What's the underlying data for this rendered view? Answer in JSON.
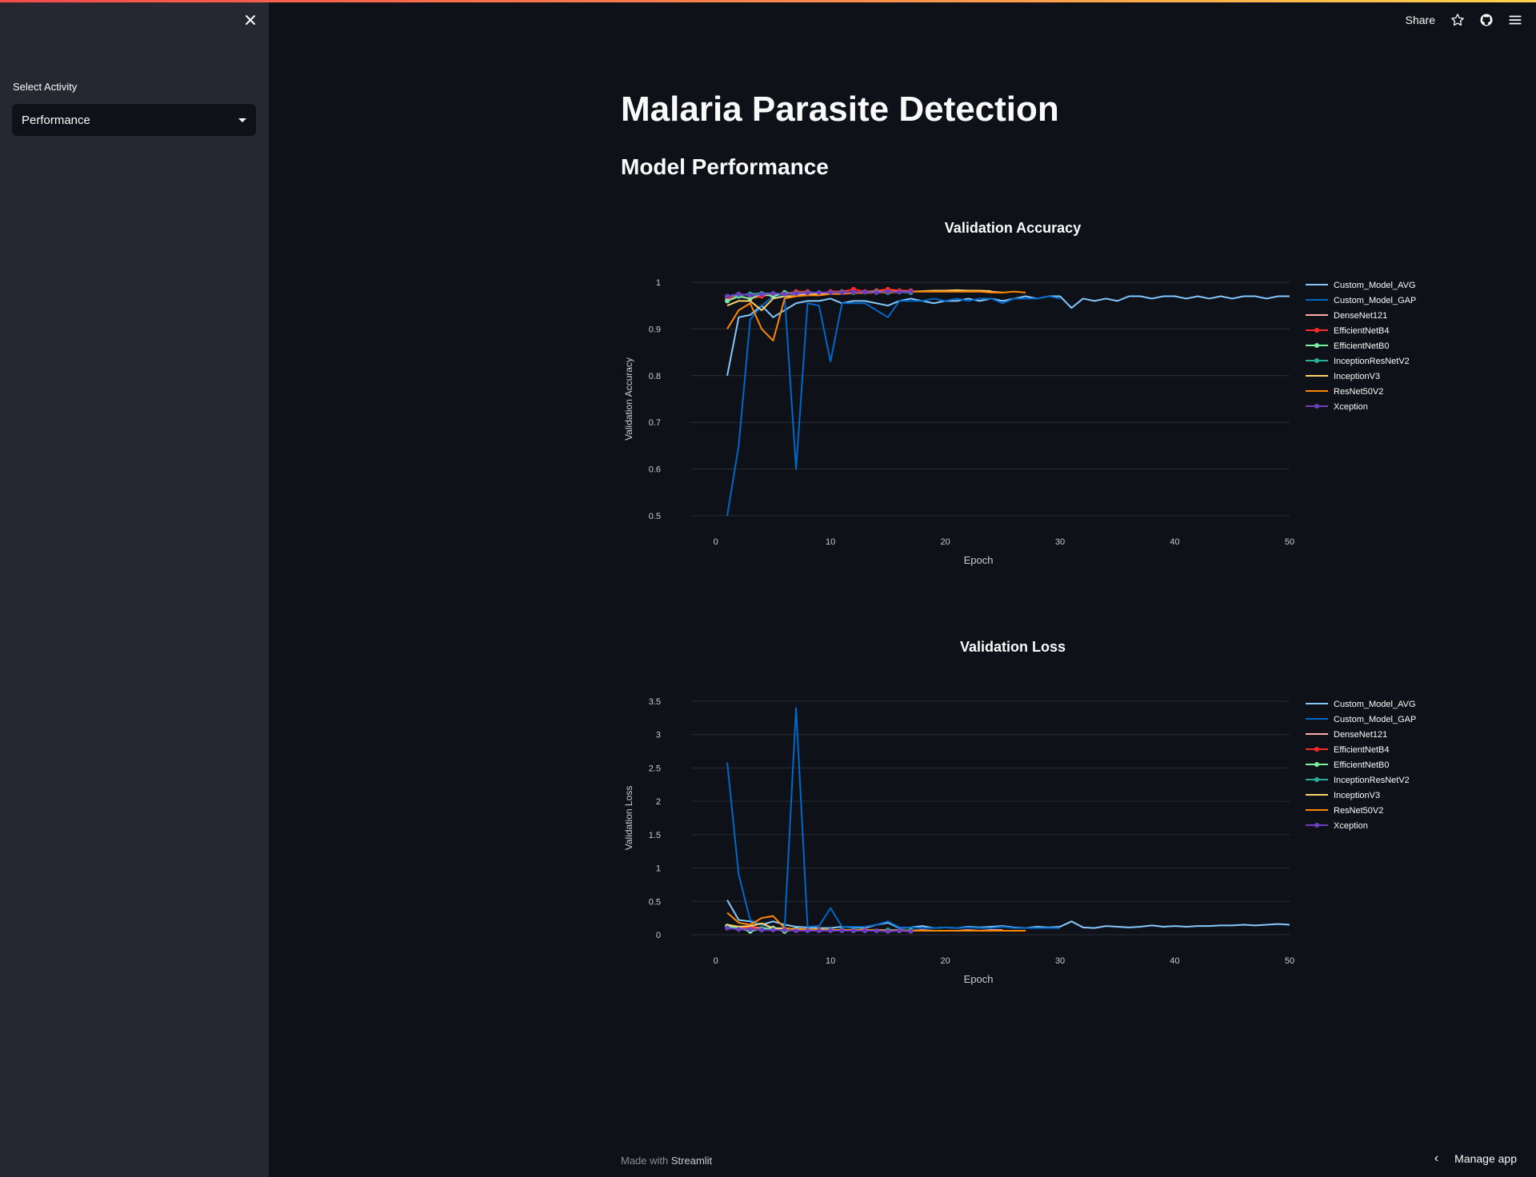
{
  "sidebar": {
    "select_label": "Select Activity",
    "select_value": "Performance"
  },
  "header": {
    "share_label": "Share"
  },
  "main": {
    "title": "Malaria Parasite Detection",
    "subtitle": "Model Performance"
  },
  "footer": {
    "made_with": "Made with",
    "brand": "Streamlit",
    "manage_app": "Manage app"
  },
  "chart_data": [
    {
      "type": "line",
      "title": "Validation Accuracy",
      "xlabel": "Epoch",
      "ylabel": "Validation Accuracy",
      "xlim": [
        -2,
        50
      ],
      "ylim": [
        0.5,
        1
      ],
      "xticks": [
        0,
        10,
        20,
        30,
        40,
        50
      ],
      "yticks": [
        0.5,
        0.6,
        0.7,
        0.8,
        0.9,
        1
      ],
      "grid": true,
      "legend_position": "right",
      "series": [
        {
          "name": "Custom_Model_AVG",
          "color": "#83c9ff",
          "marker": false,
          "x": [
            1,
            2,
            3,
            4,
            5,
            6,
            7,
            8,
            9,
            10,
            11,
            12,
            13,
            14,
            15,
            16,
            17,
            18,
            19,
            20,
            21,
            22,
            23,
            24,
            25,
            26,
            27,
            28,
            29,
            30,
            31,
            32,
            33,
            34,
            35,
            36,
            37,
            38,
            39,
            40,
            41,
            42,
            43,
            44,
            45,
            46,
            47,
            48,
            49,
            50
          ],
          "y": [
            0.8,
            0.925,
            0.93,
            0.95,
            0.925,
            0.94,
            0.955,
            0.96,
            0.96,
            0.965,
            0.955,
            0.96,
            0.96,
            0.955,
            0.95,
            0.96,
            0.965,
            0.96,
            0.955,
            0.96,
            0.96,
            0.965,
            0.96,
            0.965,
            0.96,
            0.965,
            0.97,
            0.965,
            0.97,
            0.97,
            0.945,
            0.965,
            0.96,
            0.965,
            0.96,
            0.97,
            0.97,
            0.965,
            0.97,
            0.97,
            0.965,
            0.97,
            0.965,
            0.97,
            0.965,
            0.97,
            0.97,
            0.965,
            0.97,
            0.97
          ]
        },
        {
          "name": "Custom_Model_GAP",
          "color": "#0068c9",
          "marker": false,
          "x": [
            1,
            2,
            3,
            4,
            5,
            6,
            7,
            8,
            9,
            10,
            11,
            12,
            13,
            14,
            15,
            16,
            17,
            18,
            19,
            20,
            21,
            22,
            23,
            24,
            25,
            26,
            27,
            28,
            29,
            30
          ],
          "y": [
            0.5,
            0.65,
            0.92,
            0.95,
            0.97,
            0.97,
            0.6,
            0.955,
            0.95,
            0.83,
            0.955,
            0.955,
            0.955,
            0.94,
            0.925,
            0.96,
            0.96,
            0.96,
            0.965,
            0.96,
            0.965,
            0.96,
            0.965,
            0.965,
            0.955,
            0.965,
            0.965,
            0.965,
            0.97,
            0.965
          ]
        },
        {
          "name": "DenseNet121",
          "color": "#ffabab",
          "marker": false,
          "x": [
            1,
            2,
            3,
            4,
            5,
            6,
            7,
            8,
            9,
            10,
            11,
            12,
            13,
            14,
            15,
            16,
            17,
            18,
            19,
            20,
            21,
            22,
            23,
            24,
            25
          ],
          "y": [
            0.96,
            0.97,
            0.965,
            0.97,
            0.975,
            0.975,
            0.975,
            0.975,
            0.975,
            0.98,
            0.98,
            0.978,
            0.98,
            0.98,
            0.98,
            0.98,
            0.98,
            0.98,
            0.98,
            0.98,
            0.98,
            0.98,
            0.98,
            0.98,
            0.978
          ]
        },
        {
          "name": "EfficientNetB4",
          "color": "#ff2b2b",
          "marker": true,
          "x": [
            1,
            2,
            3,
            4,
            5,
            6,
            7,
            8,
            9,
            10,
            11,
            12,
            13,
            14,
            15,
            16,
            17
          ],
          "y": [
            0.965,
            0.97,
            0.965,
            0.97,
            0.975,
            0.975,
            0.98,
            0.98,
            0.975,
            0.98,
            0.98,
            0.985,
            0.98,
            0.982,
            0.985,
            0.982,
            0.982
          ]
        },
        {
          "name": "EfficientNetB0",
          "color": "#7defa1",
          "marker": true,
          "x": [
            1,
            2,
            3,
            4,
            5,
            6,
            7
          ],
          "y": [
            0.96,
            0.97,
            0.965,
            0.975,
            0.97,
            0.978,
            0.975
          ]
        },
        {
          "name": "InceptionResNetV2",
          "color": "#29b09d",
          "marker": true,
          "x": [
            1,
            2,
            3,
            4,
            5,
            6,
            7,
            8,
            9,
            10,
            11,
            12,
            13,
            14,
            15,
            16,
            17
          ],
          "y": [
            0.97,
            0.972,
            0.975,
            0.976,
            0.976,
            0.975,
            0.977,
            0.978,
            0.978,
            0.978,
            0.979,
            0.978,
            0.979,
            0.98,
            0.978,
            0.979,
            0.978
          ]
        },
        {
          "name": "InceptionV3",
          "color": "#ffd16a",
          "marker": false,
          "x": [
            1,
            2,
            3,
            4,
            5,
            6,
            7,
            8,
            9,
            10,
            11,
            12,
            13,
            14,
            15,
            16,
            17,
            18,
            19,
            20,
            21,
            22,
            23,
            24
          ],
          "y": [
            0.95,
            0.96,
            0.96,
            0.94,
            0.965,
            0.97,
            0.97,
            0.975,
            0.975,
            0.976,
            0.977,
            0.978,
            0.978,
            0.979,
            0.98,
            0.98,
            0.98,
            0.981,
            0.982,
            0.982,
            0.983,
            0.982,
            0.982,
            0.981
          ]
        },
        {
          "name": "ResNet50V2",
          "color": "#ff8700",
          "marker": false,
          "x": [
            1,
            2,
            3,
            4,
            5,
            6,
            7,
            8,
            9,
            10,
            11,
            12,
            13,
            14,
            15,
            16,
            17,
            18,
            19,
            20,
            21,
            22,
            23,
            24,
            25,
            26,
            27
          ],
          "y": [
            0.9,
            0.94,
            0.955,
            0.9,
            0.875,
            0.965,
            0.97,
            0.972,
            0.972,
            0.975,
            0.975,
            0.977,
            0.977,
            0.978,
            0.978,
            0.979,
            0.98,
            0.98,
            0.98,
            0.98,
            0.98,
            0.98,
            0.98,
            0.978,
            0.978,
            0.98,
            0.978
          ]
        },
        {
          "name": "Xception",
          "color": "#6d3fc0",
          "marker": true,
          "x": [
            1,
            2,
            3,
            4,
            5,
            6,
            7,
            8,
            9,
            10,
            11,
            12,
            13,
            14,
            15,
            16,
            17
          ],
          "y": [
            0.97,
            0.975,
            0.972,
            0.974,
            0.976,
            0.975,
            0.976,
            0.977,
            0.978,
            0.978,
            0.978,
            0.979,
            0.979,
            0.978,
            0.98,
            0.979,
            0.98
          ]
        }
      ]
    },
    {
      "type": "line",
      "title": "Validation Loss",
      "xlabel": "Epoch",
      "ylabel": "Validation Loss",
      "xlim": [
        -2,
        50
      ],
      "ylim": [
        0,
        3.5
      ],
      "xticks": [
        0,
        10,
        20,
        30,
        40,
        50
      ],
      "yticks": [
        0,
        0.5,
        1,
        1.5,
        2,
        2.5,
        3,
        3.5
      ],
      "grid": true,
      "legend_position": "right",
      "series": [
        {
          "name": "Custom_Model_AVG",
          "color": "#83c9ff",
          "marker": false,
          "x": [
            1,
            2,
            3,
            4,
            5,
            6,
            7,
            8,
            9,
            10,
            11,
            12,
            13,
            14,
            15,
            16,
            17,
            18,
            19,
            20,
            21,
            22,
            23,
            24,
            25,
            26,
            27,
            28,
            29,
            30,
            31,
            32,
            33,
            34,
            35,
            36,
            37,
            38,
            39,
            40,
            41,
            42,
            43,
            44,
            45,
            46,
            47,
            48,
            49,
            50
          ],
          "y": [
            0.52,
            0.22,
            0.2,
            0.15,
            0.2,
            0.15,
            0.12,
            0.11,
            0.1,
            0.1,
            0.12,
            0.11,
            0.1,
            0.15,
            0.18,
            0.1,
            0.11,
            0.13,
            0.1,
            0.11,
            0.1,
            0.12,
            0.11,
            0.12,
            0.13,
            0.11,
            0.1,
            0.12,
            0.11,
            0.12,
            0.2,
            0.11,
            0.1,
            0.13,
            0.12,
            0.11,
            0.12,
            0.14,
            0.12,
            0.13,
            0.12,
            0.13,
            0.13,
            0.14,
            0.14,
            0.15,
            0.14,
            0.15,
            0.16,
            0.15
          ]
        },
        {
          "name": "Custom_Model_GAP",
          "color": "#0068c9",
          "marker": false,
          "x": [
            1,
            2,
            3,
            4,
            5,
            6,
            7,
            8,
            9,
            10,
            11,
            12,
            13,
            14,
            15,
            16,
            17,
            18,
            19,
            20,
            21,
            22,
            23,
            24,
            25,
            26,
            27,
            28,
            29,
            30
          ],
          "y": [
            2.58,
            0.9,
            0.22,
            0.15,
            0.1,
            0.1,
            3.4,
            0.12,
            0.13,
            0.4,
            0.12,
            0.12,
            0.12,
            0.15,
            0.2,
            0.11,
            0.11,
            0.1,
            0.1,
            0.11,
            0.1,
            0.11,
            0.1,
            0.1,
            0.12,
            0.1,
            0.1,
            0.1,
            0.1,
            0.1
          ]
        },
        {
          "name": "DenseNet121",
          "color": "#ffabab",
          "marker": false,
          "x": [
            1,
            2,
            3,
            4,
            5,
            6,
            7,
            8,
            9,
            10,
            11,
            12,
            13,
            14,
            15,
            16,
            17,
            18,
            19,
            20,
            21,
            22,
            23,
            24,
            25
          ],
          "y": [
            0.12,
            0.1,
            0.12,
            0.1,
            0.09,
            0.08,
            0.08,
            0.07,
            0.07,
            0.07,
            0.07,
            0.07,
            0.06,
            0.07,
            0.07,
            0.07,
            0.06,
            0.07,
            0.06,
            0.06,
            0.06,
            0.07,
            0.06,
            0.07,
            0.07
          ]
        },
        {
          "name": "EfficientNetB4",
          "color": "#ff2b2b",
          "marker": true,
          "x": [
            1,
            2,
            3,
            4,
            5,
            6,
            7,
            8,
            9,
            10,
            11,
            12,
            13,
            14,
            15,
            16,
            17
          ],
          "y": [
            0.12,
            0.1,
            0.11,
            0.09,
            0.08,
            0.08,
            0.07,
            0.07,
            0.08,
            0.07,
            0.07,
            0.06,
            0.07,
            0.06,
            0.06,
            0.06,
            0.06
          ]
        },
        {
          "name": "EfficientNetB0",
          "color": "#7defa1",
          "marker": true,
          "x": [
            1,
            2,
            3,
            4,
            5,
            6,
            7
          ],
          "y": [
            0.13,
            0.1,
            0.05,
            0.09,
            0.1,
            0.05,
            0.08
          ]
        },
        {
          "name": "InceptionResNetV2",
          "color": "#29b09d",
          "marker": true,
          "x": [
            1,
            2,
            3,
            4,
            5,
            6,
            7,
            8,
            9,
            10,
            11,
            12,
            13,
            14,
            15,
            16,
            17
          ],
          "y": [
            0.1,
            0.09,
            0.08,
            0.08,
            0.08,
            0.08,
            0.07,
            0.07,
            0.07,
            0.07,
            0.07,
            0.07,
            0.06,
            0.06,
            0.07,
            0.06,
            0.07
          ]
        },
        {
          "name": "InceptionV3",
          "color": "#ffd16a",
          "marker": false,
          "x": [
            1,
            2,
            3,
            4,
            5,
            6,
            7,
            8,
            9,
            10,
            11,
            12,
            13,
            14,
            15,
            16,
            17,
            18,
            19,
            20,
            21,
            22,
            23,
            24
          ],
          "y": [
            0.15,
            0.12,
            0.13,
            0.17,
            0.1,
            0.09,
            0.09,
            0.08,
            0.08,
            0.07,
            0.07,
            0.07,
            0.07,
            0.07,
            0.06,
            0.06,
            0.06,
            0.06,
            0.06,
            0.06,
            0.06,
            0.06,
            0.06,
            0.06
          ]
        },
        {
          "name": "ResNet50V2",
          "color": "#ff8700",
          "marker": false,
          "x": [
            1,
            2,
            3,
            4,
            5,
            6,
            7,
            8,
            9,
            10,
            11,
            12,
            13,
            14,
            15,
            16,
            17,
            18,
            19,
            20,
            21,
            22,
            23,
            24,
            25,
            26,
            27
          ],
          "y": [
            0.33,
            0.18,
            0.15,
            0.25,
            0.28,
            0.1,
            0.08,
            0.08,
            0.08,
            0.07,
            0.07,
            0.07,
            0.07,
            0.07,
            0.06,
            0.06,
            0.06,
            0.06,
            0.06,
            0.06,
            0.06,
            0.06,
            0.06,
            0.06,
            0.06,
            0.06,
            0.06
          ]
        },
        {
          "name": "Xception",
          "color": "#6d3fc0",
          "marker": true,
          "x": [
            1,
            2,
            3,
            4,
            5,
            6,
            7,
            8,
            9,
            10,
            11,
            12,
            13,
            14,
            15,
            16,
            17
          ],
          "y": [
            0.1,
            0.08,
            0.08,
            0.07,
            0.07,
            0.07,
            0.06,
            0.06,
            0.06,
            0.06,
            0.06,
            0.06,
            0.06,
            0.06,
            0.05,
            0.06,
            0.05
          ]
        }
      ]
    }
  ]
}
